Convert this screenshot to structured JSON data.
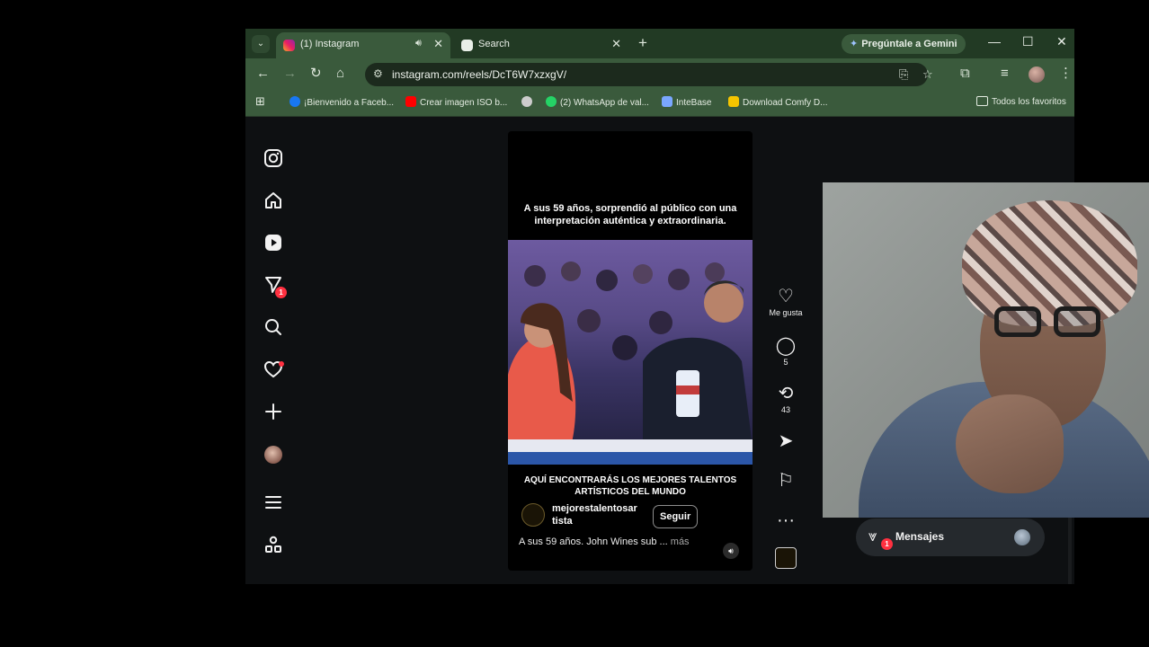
{
  "browser": {
    "tabs": [
      {
        "title": "(1) Instagram",
        "active": true,
        "favicon": "instagram-favicon",
        "audio": true
      },
      {
        "title": "Search",
        "active": false,
        "favicon": "play-favicon"
      }
    ],
    "new_tab": "+",
    "gemini_label": "Pregúntale a Gemini",
    "url": "instagram.com/reels/DcT6W7xzxgV/",
    "bookmarks": [
      {
        "label": "¡Bienvenido a Faceb...",
        "icon": "facebook-icon",
        "color": "#1877f2"
      },
      {
        "label": "Crear imagen ISO b...",
        "icon": "youtube-icon",
        "color": "#ff0000"
      },
      {
        "label": "",
        "icon": "chrome-icon",
        "color": "#cccccc"
      },
      {
        "label": "(2) WhatsApp de val...",
        "icon": "whatsapp-icon",
        "color": "#25d366"
      },
      {
        "label": "InteBase",
        "icon": "intebase-icon",
        "color": "#7aa7ff"
      },
      {
        "label": "Download Comfy D...",
        "icon": "comfy-icon",
        "color": "#f5c400"
      }
    ],
    "all_bookmarks_label": "Todos los favoritos"
  },
  "instagram": {
    "nav": [
      {
        "name": "instagram-logo-icon",
        "glyph": "◎"
      },
      {
        "name": "home-icon",
        "glyph": "⌂"
      },
      {
        "name": "reels-icon",
        "glyph": "▶"
      },
      {
        "name": "messages-nav-icon",
        "glyph": "⩔",
        "badge": "1"
      },
      {
        "name": "search-icon",
        "glyph": "⚲"
      },
      {
        "name": "notifications-icon",
        "glyph": "♡",
        "dot": true
      },
      {
        "name": "create-icon",
        "glyph": "+"
      },
      {
        "name": "more-menu-icon",
        "glyph": "☰"
      },
      {
        "name": "also-from-meta-icon",
        "glyph": "⁂"
      }
    ],
    "reel": {
      "caption": "A sus 59 años, sorprendió al público con una interpretación auténtica y extraordinaria.",
      "bottom_text": "AQUÍ ENCONTRARÁS LOS MEJORES TALENTOS ARTÍSTICOS DEL MUNDO",
      "author": "mejorestalentosar tista",
      "follow_label": "Seguir",
      "description": "A sus 59 años. John Wines sub ...",
      "more_label": "más"
    },
    "actions": {
      "like_label": "Me gusta",
      "comments": "5",
      "reposts": "43"
    },
    "messages_label": "Mensajes",
    "messages_badge": "1"
  },
  "colors": {
    "chrome_frame": "#223a24",
    "chrome_toolbar": "#3a5a3c",
    "ig_background": "#0e1012",
    "notification_red": "#ff3040"
  }
}
